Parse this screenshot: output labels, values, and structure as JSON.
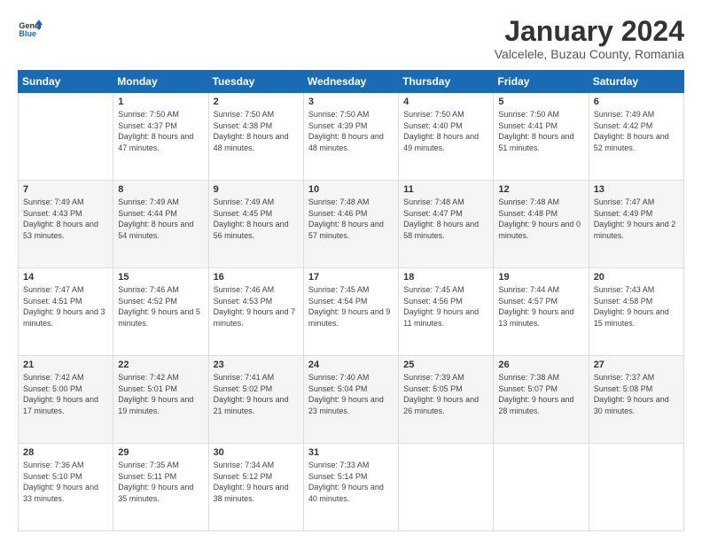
{
  "logo": {
    "line1": "General",
    "line2": "Blue"
  },
  "header": {
    "title": "January 2024",
    "subtitle": "Valcelele, Buzau County, Romania"
  },
  "weekdays": [
    "Sunday",
    "Monday",
    "Tuesday",
    "Wednesday",
    "Thursday",
    "Friday",
    "Saturday"
  ],
  "weeks": [
    [
      {
        "day": "",
        "info": ""
      },
      {
        "day": "1",
        "info": "Sunrise: 7:50 AM\nSunset: 4:37 PM\nDaylight: 8 hours\nand 47 minutes."
      },
      {
        "day": "2",
        "info": "Sunrise: 7:50 AM\nSunset: 4:38 PM\nDaylight: 8 hours\nand 48 minutes."
      },
      {
        "day": "3",
        "info": "Sunrise: 7:50 AM\nSunset: 4:39 PM\nDaylight: 8 hours\nand 48 minutes."
      },
      {
        "day": "4",
        "info": "Sunrise: 7:50 AM\nSunset: 4:40 PM\nDaylight: 8 hours\nand 49 minutes."
      },
      {
        "day": "5",
        "info": "Sunrise: 7:50 AM\nSunset: 4:41 PM\nDaylight: 8 hours\nand 51 minutes."
      },
      {
        "day": "6",
        "info": "Sunrise: 7:49 AM\nSunset: 4:42 PM\nDaylight: 8 hours\nand 52 minutes."
      }
    ],
    [
      {
        "day": "7",
        "info": "Sunrise: 7:49 AM\nSunset: 4:43 PM\nDaylight: 8 hours\nand 53 minutes."
      },
      {
        "day": "8",
        "info": "Sunrise: 7:49 AM\nSunset: 4:44 PM\nDaylight: 8 hours\nand 54 minutes."
      },
      {
        "day": "9",
        "info": "Sunrise: 7:49 AM\nSunset: 4:45 PM\nDaylight: 8 hours\nand 56 minutes."
      },
      {
        "day": "10",
        "info": "Sunrise: 7:48 AM\nSunset: 4:46 PM\nDaylight: 8 hours\nand 57 minutes."
      },
      {
        "day": "11",
        "info": "Sunrise: 7:48 AM\nSunset: 4:47 PM\nDaylight: 8 hours\nand 58 minutes."
      },
      {
        "day": "12",
        "info": "Sunrise: 7:48 AM\nSunset: 4:48 PM\nDaylight: 9 hours\nand 0 minutes."
      },
      {
        "day": "13",
        "info": "Sunrise: 7:47 AM\nSunset: 4:49 PM\nDaylight: 9 hours\nand 2 minutes."
      }
    ],
    [
      {
        "day": "14",
        "info": "Sunrise: 7:47 AM\nSunset: 4:51 PM\nDaylight: 9 hours\nand 3 minutes."
      },
      {
        "day": "15",
        "info": "Sunrise: 7:46 AM\nSunset: 4:52 PM\nDaylight: 9 hours\nand 5 minutes."
      },
      {
        "day": "16",
        "info": "Sunrise: 7:46 AM\nSunset: 4:53 PM\nDaylight: 9 hours\nand 7 minutes."
      },
      {
        "day": "17",
        "info": "Sunrise: 7:45 AM\nSunset: 4:54 PM\nDaylight: 9 hours\nand 9 minutes."
      },
      {
        "day": "18",
        "info": "Sunrise: 7:45 AM\nSunset: 4:56 PM\nDaylight: 9 hours\nand 11 minutes."
      },
      {
        "day": "19",
        "info": "Sunrise: 7:44 AM\nSunset: 4:57 PM\nDaylight: 9 hours\nand 13 minutes."
      },
      {
        "day": "20",
        "info": "Sunrise: 7:43 AM\nSunset: 4:58 PM\nDaylight: 9 hours\nand 15 minutes."
      }
    ],
    [
      {
        "day": "21",
        "info": "Sunrise: 7:42 AM\nSunset: 5:00 PM\nDaylight: 9 hours\nand 17 minutes."
      },
      {
        "day": "22",
        "info": "Sunrise: 7:42 AM\nSunset: 5:01 PM\nDaylight: 9 hours\nand 19 minutes."
      },
      {
        "day": "23",
        "info": "Sunrise: 7:41 AM\nSunset: 5:02 PM\nDaylight: 9 hours\nand 21 minutes."
      },
      {
        "day": "24",
        "info": "Sunrise: 7:40 AM\nSunset: 5:04 PM\nDaylight: 9 hours\nand 23 minutes."
      },
      {
        "day": "25",
        "info": "Sunrise: 7:39 AM\nSunset: 5:05 PM\nDaylight: 9 hours\nand 26 minutes."
      },
      {
        "day": "26",
        "info": "Sunrise: 7:38 AM\nSunset: 5:07 PM\nDaylight: 9 hours\nand 28 minutes."
      },
      {
        "day": "27",
        "info": "Sunrise: 7:37 AM\nSunset: 5:08 PM\nDaylight: 9 hours\nand 30 minutes."
      }
    ],
    [
      {
        "day": "28",
        "info": "Sunrise: 7:36 AM\nSunset: 5:10 PM\nDaylight: 9 hours\nand 33 minutes."
      },
      {
        "day": "29",
        "info": "Sunrise: 7:35 AM\nSunset: 5:11 PM\nDaylight: 9 hours\nand 35 minutes."
      },
      {
        "day": "30",
        "info": "Sunrise: 7:34 AM\nSunset: 5:12 PM\nDaylight: 9 hours\nand 38 minutes."
      },
      {
        "day": "31",
        "info": "Sunrise: 7:33 AM\nSunset: 5:14 PM\nDaylight: 9 hours\nand 40 minutes."
      },
      {
        "day": "",
        "info": ""
      },
      {
        "day": "",
        "info": ""
      },
      {
        "day": "",
        "info": ""
      }
    ]
  ]
}
